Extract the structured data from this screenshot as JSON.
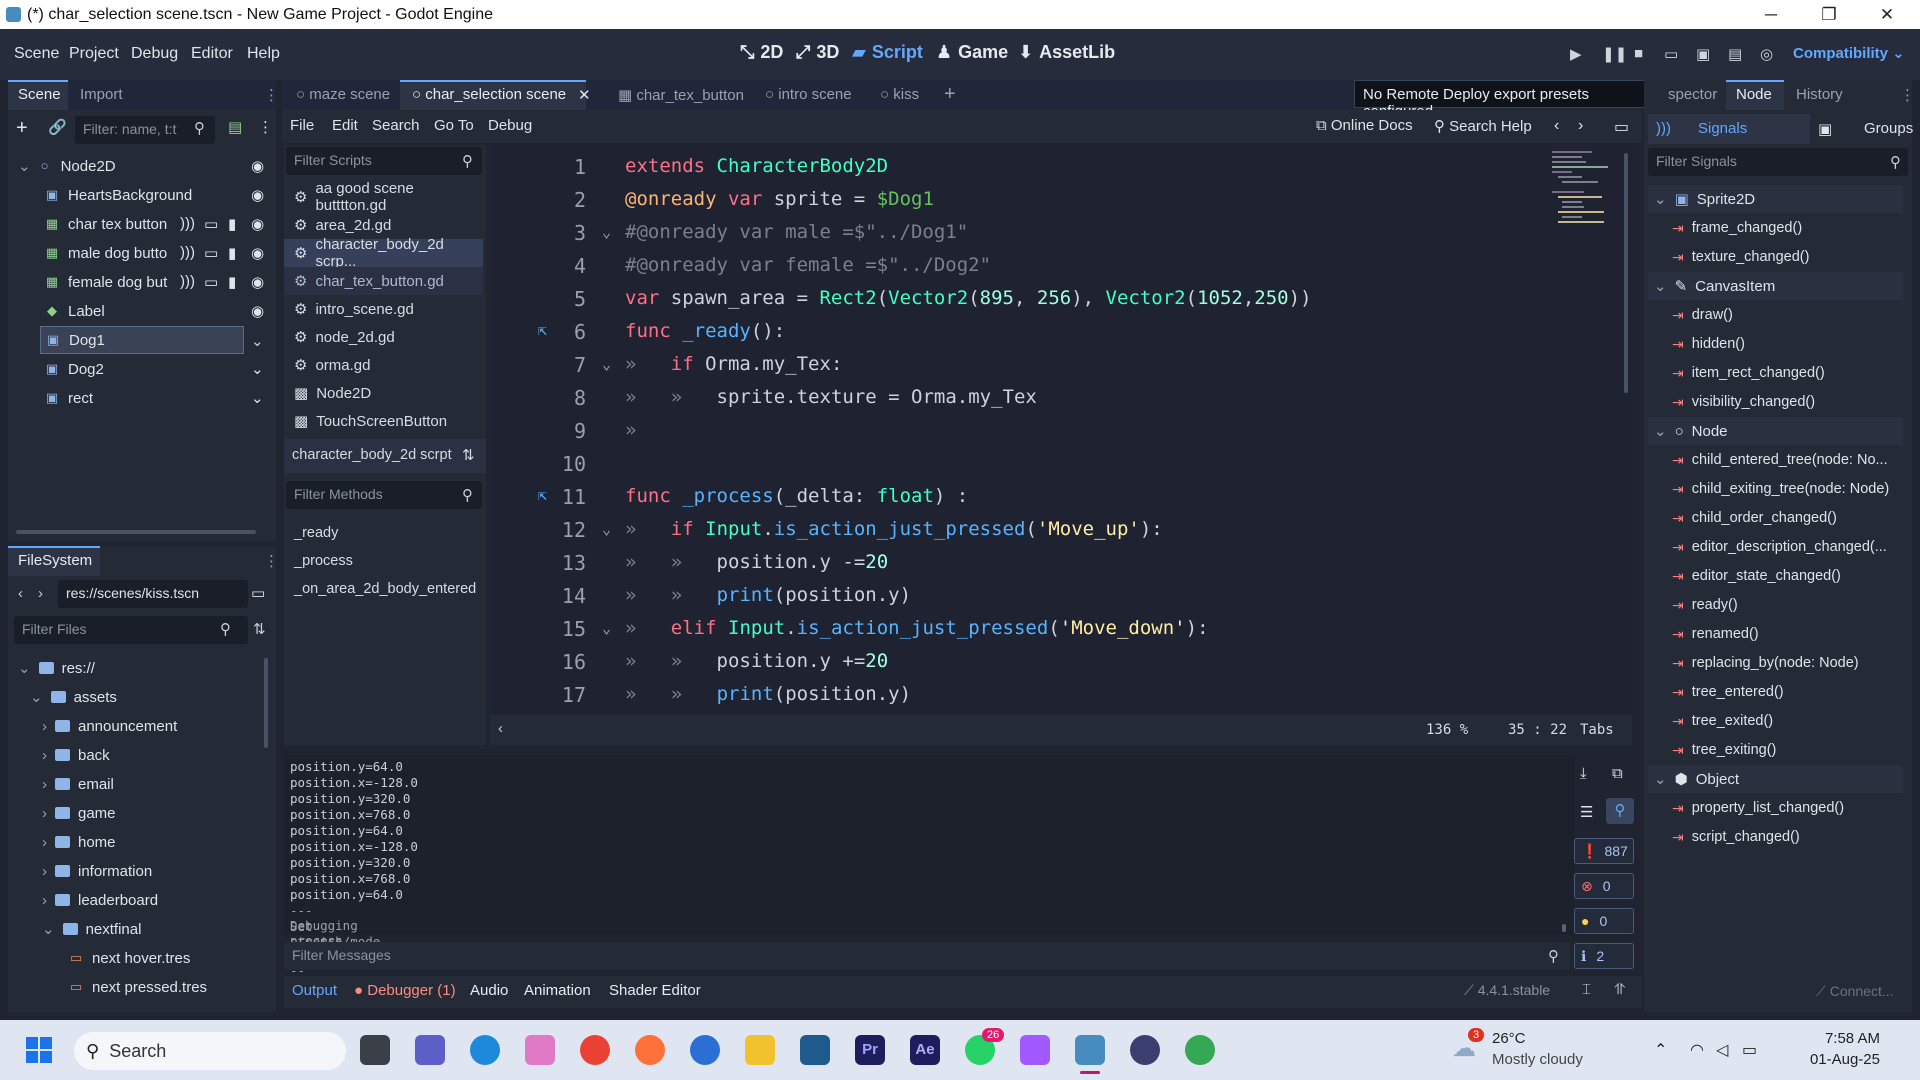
{
  "window": {
    "title": "(*) char_selection scene.tscn - New Game Project - Godot Engine"
  },
  "menu": [
    "Scene",
    "Project",
    "Debug",
    "Editor",
    "Help"
  ],
  "workspaces": [
    {
      "icon": "2d-icon",
      "label": "2D",
      "glyph": "⤡"
    },
    {
      "icon": "3d-icon",
      "label": "3D",
      "glyph": "⤢"
    },
    {
      "icon": "script-icon",
      "label": "Script",
      "glyph": "▰"
    },
    {
      "icon": "game-icon",
      "label": "Game",
      "glyph": "♟"
    },
    {
      "icon": "assetlib-icon",
      "label": "AssetLib",
      "glyph": "⬇"
    }
  ],
  "renderer": "Compatibility",
  "scene_dock": {
    "tabs": [
      "Scene",
      "Import"
    ],
    "filter_placeholder": "Filter: name, t:t",
    "nodes": [
      {
        "name": "Node2D",
        "indent": 0
      },
      {
        "name": "HeartsBackground",
        "indent": 1
      },
      {
        "name": "char tex button",
        "indent": 1
      },
      {
        "name": "male dog butto",
        "indent": 1
      },
      {
        "name": "female dog but",
        "indent": 1
      },
      {
        "name": "Label",
        "indent": 1
      },
      {
        "name": "Dog1",
        "indent": 1
      },
      {
        "name": "Dog2",
        "indent": 1
      },
      {
        "name": "rect",
        "indent": 1
      }
    ]
  },
  "filesystem": {
    "title": "FileSystem",
    "path": "res://scenes/kiss.tscn",
    "filter_placeholder": "Filter Files",
    "items": [
      {
        "label": "res://",
        "level": 0,
        "type": "folder"
      },
      {
        "label": "assets",
        "level": 1,
        "type": "folder"
      },
      {
        "label": "announcement",
        "level": 2,
        "type": "folder"
      },
      {
        "label": "back",
        "level": 2,
        "type": "folder"
      },
      {
        "label": "email",
        "level": 2,
        "type": "folder"
      },
      {
        "label": "game",
        "level": 2,
        "type": "folder"
      },
      {
        "label": "home",
        "level": 2,
        "type": "folder"
      },
      {
        "label": "information",
        "level": 2,
        "type": "folder"
      },
      {
        "label": "leaderboard",
        "level": 2,
        "type": "folder"
      },
      {
        "label": "nextfinal",
        "level": 2,
        "type": "folder"
      },
      {
        "label": "next hover.tres",
        "level": 3,
        "type": "file"
      },
      {
        "label": "next pressed.tres",
        "level": 3,
        "type": "file"
      }
    ]
  },
  "editor_tabs": [
    "maze scene",
    "char_selection scene",
    "char_tex_button",
    "intro scene",
    "kiss"
  ],
  "script_menu": [
    "File",
    "Edit",
    "Search",
    "Go To",
    "Debug"
  ],
  "online_docs": "Online Docs",
  "search_help": "Search Help",
  "tooltip": "No Remote Deploy export presets configured.",
  "scripts": {
    "filter_placeholder": "Filter Scripts",
    "list": [
      "aa good scene butttton.gd",
      "area_2d.gd",
      "character_body_2d scrp...",
      "char_tex_button.gd",
      "intro_scene.gd",
      "node_2d.gd",
      "orma.gd",
      "Node2D",
      "TouchScreenButton"
    ],
    "current": "character_body_2d scrpt",
    "methods_placeholder": "Filter Methods",
    "methods": [
      "_ready",
      "_process",
      "_on_area_2d_body_entered"
    ]
  },
  "code_lines": [
    "1",
    "2",
    "3",
    "4",
    "5",
    "6",
    "7",
    "8",
    "9",
    "10",
    "11",
    "12",
    "13",
    "14",
    "15",
    "16",
    "17"
  ],
  "status": {
    "zoom": "136 %",
    "position": "35 :  22",
    "indent": "Tabs"
  },
  "output": {
    "lines": [
      "position.y=64.0",
      "position.x=-128.0",
      "position.y=320.0",
      "position.x=768.0",
      "position.y=64.0",
      "position.x=-128.0",
      "position.y=320.0",
      "position.x=768.0",
      "position.y=64.0",
      "--- Debugging process stopped ---",
      "Set stretch/mode"
    ],
    "filter_placeholder": "Filter Messages",
    "counts": {
      "messages": "887",
      "errors": "0",
      "warnings": "0",
      "info": "2"
    }
  },
  "bottom_tabs": [
    "Output",
    "Debugger (1)",
    "Audio",
    "Animation",
    "Shader Editor"
  ],
  "version": "4.4.1.stable",
  "inspector_tabs": [
    "spector",
    "Node",
    "History"
  ],
  "node_dock": {
    "tabs": [
      "Signals",
      "Groups"
    ],
    "filter_placeholder": "Filter Signals",
    "groups": [
      {
        "name": "Sprite2D",
        "signals": [
          "frame_changed()",
          "texture_changed()"
        ]
      },
      {
        "name": "CanvasItem",
        "signals": [
          "draw()",
          "hidden()",
          "item_rect_changed()",
          "visibility_changed()"
        ]
      },
      {
        "name": "Node",
        "signals": [
          "child_entered_tree(node: No...",
          "child_exiting_tree(node: Node)",
          "child_order_changed()",
          "editor_description_changed(...",
          "editor_state_changed()",
          "ready()",
          "renamed()",
          "replacing_by(node: Node)",
          "tree_entered()",
          "tree_exited()",
          "tree_exiting()"
        ]
      },
      {
        "name": "Object",
        "signals": [
          "property_list_changed()",
          "script_changed()"
        ]
      }
    ],
    "connect": "Connect..."
  },
  "taskbar": {
    "search": "Search",
    "weather_temp": "26°C",
    "weather_desc": "Mostly cloudy",
    "weather_badge": "3",
    "whatsapp_badge": "26",
    "time": "7:58 AM",
    "date": "01-Aug-25"
  }
}
